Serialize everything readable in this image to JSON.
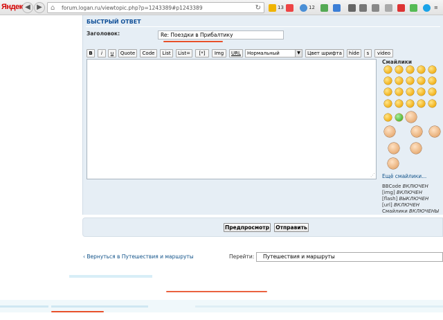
{
  "browser": {
    "logo": "Яндекс",
    "url": "forum.logan.ru/viewtopic.php?p=1243389#p1243389",
    "toolbar_items": [
      {
        "label": "13",
        "icon": "mail-icon",
        "color": "#f0b400"
      },
      {
        "label": "12",
        "icon": "weather-icon",
        "color": "#4a8fd6"
      }
    ]
  },
  "quick_reply": {
    "title": "БЫСТРЫЙ ОТВЕТ",
    "subject_label": "Заголовок:",
    "subject_value": "Re: Поездки в Прибалтику",
    "buttons": [
      "B",
      "i",
      "u",
      "Quote",
      "Code",
      "List",
      "List=",
      "[*]",
      "Img",
      "URL"
    ],
    "font_size_select": "Нормальный",
    "extra_buttons": [
      "Цвет шрифта",
      "hide",
      "s",
      "video"
    ],
    "smilies_title": "Смайлики",
    "more_smilies": "Ещё смайлики...",
    "status": [
      {
        "name": "BBCode",
        "state": "ВКЛЮЧЕН"
      },
      {
        "name": "[img]",
        "state": "ВКЛЮЧЕН"
      },
      {
        "name": "[flash]",
        "state": "ВЫКЛЮЧЕН"
      },
      {
        "name": "[url]",
        "state": "ВКЛЮЧЕН"
      },
      {
        "name": "Смайлики",
        "state": "ВКЛЮЧЕНЫ"
      }
    ]
  },
  "submit": {
    "preview": "Предпросмотр",
    "send": "Отправить"
  },
  "navigation": {
    "back_link": "Вернуться в Путешествия и маршруты",
    "jump_label": "Перейти:",
    "jump_value": "Путешествия и маршруты"
  },
  "colors": {
    "panel_bg": "#e6eef5",
    "link": "#105289",
    "title": "#115098",
    "annotation": "#e8502a"
  }
}
